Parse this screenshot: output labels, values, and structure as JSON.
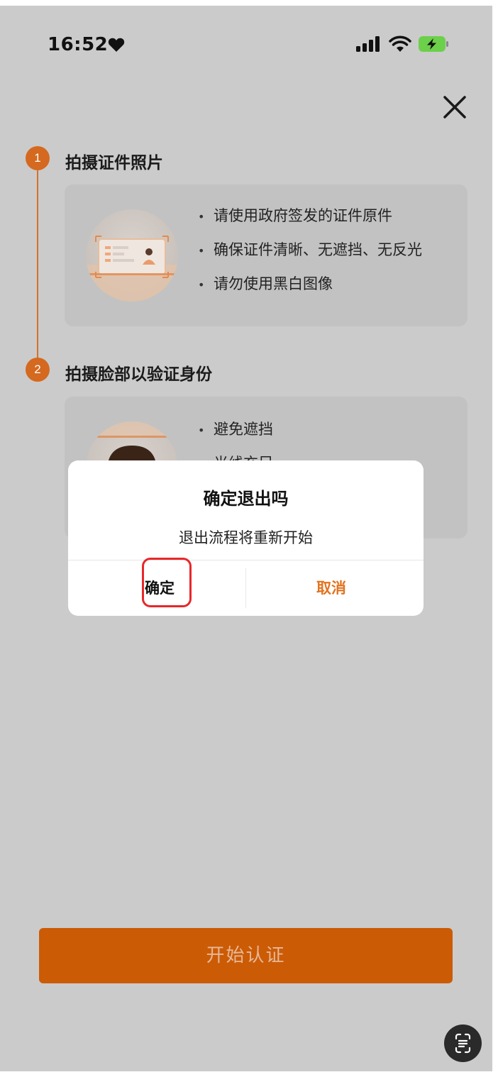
{
  "status_bar": {
    "time": "16:52",
    "heart_icon": "heart-icon",
    "signal_icon": "cellular-signal-icon",
    "wifi_icon": "wifi-icon",
    "battery_icon": "battery-charging-icon"
  },
  "header": {
    "close_icon": "close-icon"
  },
  "steps": [
    {
      "number": "1",
      "title": "拍摄证件照片",
      "tips": [
        "请使用政府签发的证件原件",
        "确保证件清晰、无遮挡、无反光",
        "请勿使用黑白图像"
      ],
      "illustration": "id-card-illustration"
    },
    {
      "number": "2",
      "title": "拍摄脸部以验证身份",
      "tips": [
        "避免遮挡",
        "光线充足"
      ],
      "illustration": "face-illustration"
    }
  ],
  "dialog": {
    "title": "确定退出吗",
    "message": "退出流程将重新开始",
    "confirm_label": "确定",
    "cancel_label": "取消"
  },
  "footer": {
    "start_button_label": "开始认证",
    "scan_icon": "scan-text-icon"
  },
  "colors": {
    "accent": "#cc5b06",
    "step_circle": "#d4691f",
    "cancel_text": "#e2731f",
    "highlight": "#e8272a",
    "overlay_bg": "#cbcbcb"
  }
}
